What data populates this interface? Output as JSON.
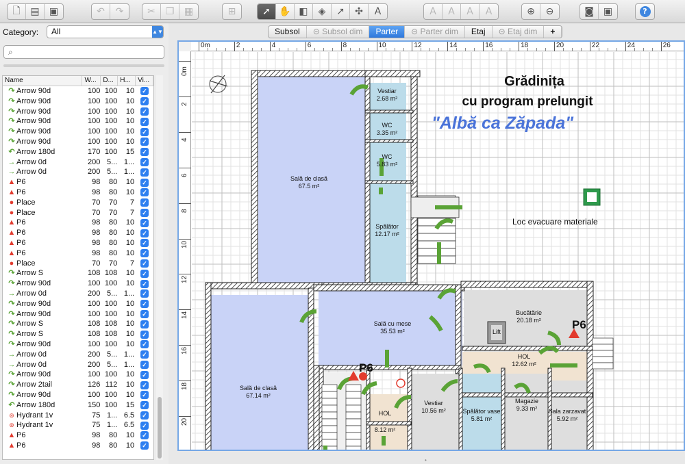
{
  "toolbar": {
    "groups": [
      [
        "new-icon",
        "open-icon",
        "save-icon"
      ],
      [
        "undo-icon",
        "redo-icon"
      ],
      [
        "cut-icon",
        "copy-icon",
        "paste-icon"
      ],
      [
        "add-furniture-icon"
      ],
      [
        "select-icon",
        "pan-icon",
        "create-walls-icon",
        "create-rooms-icon",
        "create-polylines-icon",
        "create-dimensions-icon",
        "create-labels-icon"
      ],
      [
        "text-style-icon",
        "text-size-icon",
        "bold-icon",
        "italic-icon"
      ],
      [
        "zoom-in-icon",
        "zoom-out-icon"
      ],
      [
        "photo-icon",
        "video-icon"
      ],
      [
        "help-icon"
      ]
    ]
  },
  "sidebar": {
    "category_label": "Category:",
    "category_value": "All",
    "search_placeholder": "",
    "columns": [
      "Name",
      "W...",
      "D...",
      "H...",
      "Vi..."
    ],
    "rows": [
      {
        "icon": "arrow-green",
        "name": "Arrow 90d",
        "w": "100",
        "d": "100",
        "h": "10"
      },
      {
        "icon": "arrow-green",
        "name": "Arrow 90d",
        "w": "100",
        "d": "100",
        "h": "10"
      },
      {
        "icon": "arrow-green",
        "name": "Arrow 90d",
        "w": "100",
        "d": "100",
        "h": "10"
      },
      {
        "icon": "arrow-green",
        "name": "Arrow 90d",
        "w": "100",
        "d": "100",
        "h": "10"
      },
      {
        "icon": "arrow-green",
        "name": "Arrow 90d",
        "w": "100",
        "d": "100",
        "h": "10"
      },
      {
        "icon": "arrow-green",
        "name": "Arrow 90d",
        "w": "100",
        "d": "100",
        "h": "10"
      },
      {
        "icon": "arrow-curve",
        "name": "Arrow 180d",
        "w": "170",
        "d": "100",
        "h": "15"
      },
      {
        "icon": "arrow-straight",
        "name": "Arrow 0d",
        "w": "200",
        "d": "5...",
        "h": "1..."
      },
      {
        "icon": "arrow-straight",
        "name": "Arrow 0d",
        "w": "200",
        "d": "5...",
        "h": "1..."
      },
      {
        "icon": "triangle-red",
        "name": "P6",
        "w": "98",
        "d": "80",
        "h": "10"
      },
      {
        "icon": "triangle-red",
        "name": "P6",
        "w": "98",
        "d": "80",
        "h": "10"
      },
      {
        "icon": "circle-red",
        "name": "Place",
        "w": "70",
        "d": "70",
        "h": "7"
      },
      {
        "icon": "circle-red",
        "name": "Place",
        "w": "70",
        "d": "70",
        "h": "7"
      },
      {
        "icon": "triangle-red",
        "name": "P6",
        "w": "98",
        "d": "80",
        "h": "10"
      },
      {
        "icon": "triangle-red",
        "name": "P6",
        "w": "98",
        "d": "80",
        "h": "10"
      },
      {
        "icon": "triangle-red",
        "name": "P6",
        "w": "98",
        "d": "80",
        "h": "10"
      },
      {
        "icon": "triangle-red",
        "name": "P6",
        "w": "98",
        "d": "80",
        "h": "10"
      },
      {
        "icon": "circle-red",
        "name": "Place",
        "w": "70",
        "d": "70",
        "h": "7"
      },
      {
        "icon": "arrow-green",
        "name": "Arrow S",
        "w": "108",
        "d": "108",
        "h": "10"
      },
      {
        "icon": "arrow-green",
        "name": "Arrow 90d",
        "w": "100",
        "d": "100",
        "h": "10"
      },
      {
        "icon": "arrow-straight",
        "name": "Arrow 0d",
        "w": "200",
        "d": "5...",
        "h": "1..."
      },
      {
        "icon": "arrow-green",
        "name": "Arrow 90d",
        "w": "100",
        "d": "100",
        "h": "10"
      },
      {
        "icon": "arrow-green",
        "name": "Arrow 90d",
        "w": "100",
        "d": "100",
        "h": "10"
      },
      {
        "icon": "arrow-green",
        "name": "Arrow S",
        "w": "108",
        "d": "108",
        "h": "10"
      },
      {
        "icon": "arrow-green",
        "name": "Arrow S",
        "w": "108",
        "d": "108",
        "h": "10"
      },
      {
        "icon": "arrow-green",
        "name": "Arrow 90d",
        "w": "100",
        "d": "100",
        "h": "10"
      },
      {
        "icon": "arrow-straight",
        "name": "Arrow 0d",
        "w": "200",
        "d": "5...",
        "h": "1..."
      },
      {
        "icon": "arrow-straight",
        "name": "Arrow 0d",
        "w": "200",
        "d": "5...",
        "h": "1..."
      },
      {
        "icon": "arrow-green",
        "name": "Arrow 90d",
        "w": "100",
        "d": "100",
        "h": "10"
      },
      {
        "icon": "arrow-green",
        "name": "Arrow 2tail",
        "w": "126",
        "d": "112",
        "h": "10"
      },
      {
        "icon": "arrow-green",
        "name": "Arrow 90d",
        "w": "100",
        "d": "100",
        "h": "10"
      },
      {
        "icon": "arrow-curve",
        "name": "Arrow 180d",
        "w": "150",
        "d": "100",
        "h": "15"
      },
      {
        "icon": "hydrant",
        "name": "Hydrant 1v",
        "w": "75",
        "d": "1...",
        "h": "6.5"
      },
      {
        "icon": "hydrant",
        "name": "Hydrant 1v",
        "w": "75",
        "d": "1...",
        "h": "6.5"
      },
      {
        "icon": "triangle-red",
        "name": "P6",
        "w": "98",
        "d": "80",
        "h": "10"
      },
      {
        "icon": "triangle-red",
        "name": "P6",
        "w": "98",
        "d": "80",
        "h": "10"
      }
    ]
  },
  "levels": {
    "tabs": [
      {
        "label": "Subsol",
        "state": "normal"
      },
      {
        "label": "Subsol dim",
        "state": "dim"
      },
      {
        "label": "Parter",
        "state": "active"
      },
      {
        "label": "Parter dim",
        "state": "dim"
      },
      {
        "label": "Etaj",
        "state": "normal"
      },
      {
        "label": "Etaj dim",
        "state": "dim"
      }
    ],
    "add_label": "+"
  },
  "rulers": {
    "horizontal": [
      "0m",
      "2",
      "4",
      "6",
      "8",
      "10",
      "12",
      "14",
      "16",
      "18",
      "20",
      "22",
      "24",
      "26"
    ],
    "vertical": [
      "0m",
      "2",
      "4",
      "6",
      "8",
      "10",
      "12",
      "14",
      "16",
      "18",
      "20"
    ]
  },
  "plan": {
    "title_line1": "Grădinița",
    "title_line2": "cu program prelungit",
    "title_line3": "\"Albă ca Zăpada\"",
    "evac_label": "Loc evacuare materiale",
    "p6_label": "P6",
    "rooms": [
      {
        "id": "sala1",
        "name": "Sală de clasă",
        "area": "67.5 m²"
      },
      {
        "id": "vestiar1",
        "name": "Vestiar",
        "area": "2.68 m²"
      },
      {
        "id": "wc1",
        "name": "WC",
        "area": "3.35 m²"
      },
      {
        "id": "wc2",
        "name": "WC",
        "area": "5.83 m²"
      },
      {
        "id": "spalator1",
        "name": "Spălător",
        "area": "12.17 m²"
      },
      {
        "id": "sala_mese",
        "name": "Sală cu mese",
        "area": "35.53 m²"
      },
      {
        "id": "bucatarie",
        "name": "Bucătărie",
        "area": "20.18 m²"
      },
      {
        "id": "lift",
        "name": "Lift",
        "area": ""
      },
      {
        "id": "hol1",
        "name": "HOL",
        "area": "12.62 m²"
      },
      {
        "id": "sala2",
        "name": "Sală de clasă",
        "area": "67.14 m²"
      },
      {
        "id": "vestiar2",
        "name": "Vestiar",
        "area": "10.56 m²"
      },
      {
        "id": "spalator_vase",
        "name": "Spălător vase",
        "area": "5.81 m²"
      },
      {
        "id": "magazie",
        "name": "Magazie",
        "area": "9.33 m²"
      },
      {
        "id": "sala_zarzavat",
        "name": "Sala zarzavat",
        "area": "5.92 m²"
      },
      {
        "id": "hol2",
        "name": "HOL",
        "area": ""
      },
      {
        "id": "r812",
        "name": "",
        "area": "8.12 m²"
      }
    ]
  },
  "colors": {
    "accent": "#2f78dc",
    "room_blue": "#c9d3f7",
    "room_cyan": "#bcdcea",
    "room_tan": "#f1e3d1",
    "arrow_green": "#5aa336",
    "p6_red": "#e23b2e",
    "title_blue": "#4a73d9"
  }
}
